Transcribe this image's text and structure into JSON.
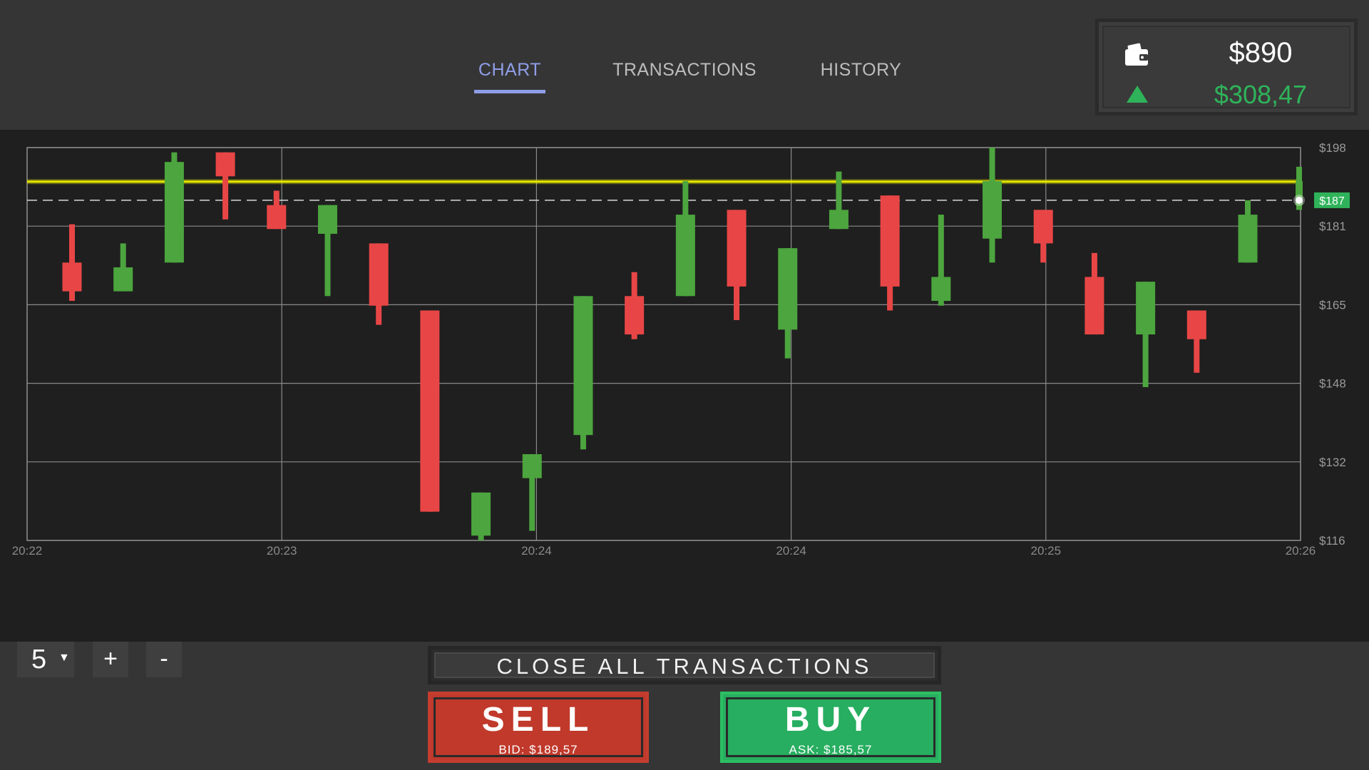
{
  "tabs": [
    {
      "label": "CHART",
      "active": true
    },
    {
      "label": "TRANSACTIONS",
      "active": false
    },
    {
      "label": "HISTORY",
      "active": false
    }
  ],
  "balance": {
    "icon": "wallet-icon",
    "value": "$890"
  },
  "profit": {
    "icon": "triangle-up-icon",
    "value": "$308,47",
    "color": "#2fb35a"
  },
  "controls": {
    "zoom_value": "5",
    "plus": "+",
    "minus": "-"
  },
  "close_all_label": "CLOSE ALL TRANSACTIONS",
  "sell": {
    "label": "SELL",
    "sub": "BID:  $189,57",
    "color": "#c0392b"
  },
  "buy": {
    "label": "BUY",
    "sub": "ASK: $185,57",
    "color": "#27ae60"
  },
  "chart_data": {
    "type": "candlestick",
    "ylim": [
      116,
      198
    ],
    "y_ticks": [
      "$198",
      "$181",
      "$165",
      "$148",
      "$132",
      "$116"
    ],
    "y_tick_values": [
      198,
      181.6,
      165.2,
      148.8,
      132.4,
      116
    ],
    "x_ticks": [
      "20:22",
      "20:23",
      "20:24",
      "20:24",
      "20:25",
      "20:26"
    ],
    "current_price_label": "$187",
    "current_price": 187,
    "highlight_line_value": 190.9,
    "colors": {
      "up": "#4ca53e",
      "down": "#e84646",
      "highlight": "#e6e600",
      "grid": "#8a8a8a"
    },
    "candles": [
      {
        "open": 174,
        "close": 168,
        "high": 182,
        "low": 166
      },
      {
        "open": 168,
        "close": 173,
        "high": 178,
        "low": 168
      },
      {
        "open": 174,
        "close": 195,
        "high": 197,
        "low": 174
      },
      {
        "open": 197,
        "close": 192,
        "high": 197,
        "low": 183
      },
      {
        "open": 186,
        "close": 181,
        "high": 189,
        "low": 181
      },
      {
        "open": 180,
        "close": 186,
        "high": 186,
        "low": 167
      },
      {
        "open": 178,
        "close": 165,
        "high": 178,
        "low": 161
      },
      {
        "open": 164,
        "close": 122,
        "high": 164,
        "low": 122
      },
      {
        "open": 117,
        "close": 126,
        "high": 126,
        "low": 116
      },
      {
        "open": 129,
        "close": 134,
        "high": 134,
        "low": 118
      },
      {
        "open": 138,
        "close": 167,
        "high": 167,
        "low": 135
      },
      {
        "open": 167,
        "close": 159,
        "high": 172,
        "low": 158
      },
      {
        "open": 167,
        "close": 184,
        "high": 191,
        "low": 167
      },
      {
        "open": 185,
        "close": 169,
        "high": 185,
        "low": 162
      },
      {
        "open": 160,
        "close": 177,
        "high": 177,
        "low": 154
      },
      {
        "open": 181,
        "close": 185,
        "high": 193,
        "low": 181
      },
      {
        "open": 188,
        "close": 169,
        "high": 188,
        "low": 164
      },
      {
        "open": 166,
        "close": 171,
        "high": 184,
        "low": 165
      },
      {
        "open": 179,
        "close": 191,
        "high": 198,
        "low": 174
      },
      {
        "open": 185,
        "close": 178,
        "high": 185,
        "low": 174
      },
      {
        "open": 171,
        "close": 159,
        "high": 176,
        "low": 159
      },
      {
        "open": 159,
        "close": 170,
        "high": 170,
        "low": 148
      },
      {
        "open": 164,
        "close": 158,
        "high": 164,
        "low": 151
      },
      {
        "open": 174,
        "close": 184,
        "high": 187,
        "low": 174
      },
      {
        "open": 186,
        "close": 191,
        "high": 194,
        "low": 185
      }
    ]
  }
}
